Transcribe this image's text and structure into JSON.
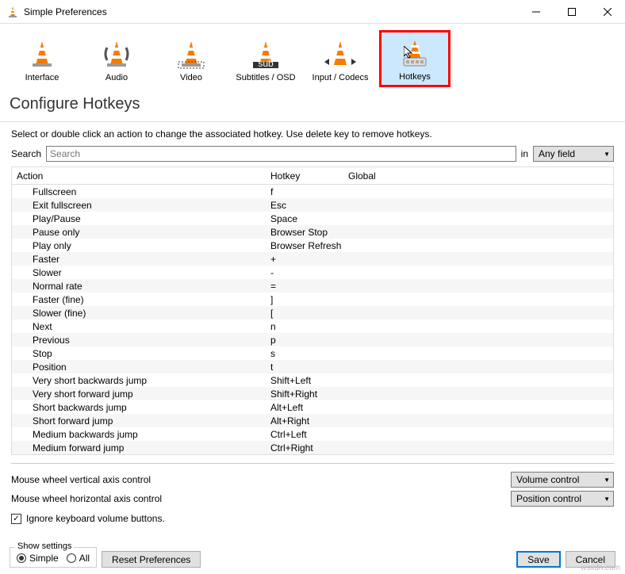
{
  "window": {
    "title": "Simple Preferences"
  },
  "tabs": {
    "items": [
      {
        "label": "Interface"
      },
      {
        "label": "Audio"
      },
      {
        "label": "Video"
      },
      {
        "label": "Subtitles / OSD"
      },
      {
        "label": "Input / Codecs"
      },
      {
        "label": "Hotkeys"
      }
    ]
  },
  "page": {
    "title": "Configure Hotkeys",
    "info": "Select or double click an action to change the associated hotkey. Use delete key to remove hotkeys.",
    "search_label": "Search",
    "search_placeholder": "Search",
    "in_label": "in",
    "search_field_select": "Any field"
  },
  "table": {
    "headers": {
      "action": "Action",
      "hotkey": "Hotkey",
      "global": "Global"
    },
    "rows": [
      {
        "action": "Fullscreen",
        "hotkey": "f",
        "global": ""
      },
      {
        "action": "Exit fullscreen",
        "hotkey": "Esc",
        "global": ""
      },
      {
        "action": "Play/Pause",
        "hotkey": "Space",
        "global": ""
      },
      {
        "action": "Pause only",
        "hotkey": "Browser Stop",
        "global": ""
      },
      {
        "action": "Play only",
        "hotkey": "Browser Refresh",
        "global": ""
      },
      {
        "action": "Faster",
        "hotkey": "+",
        "global": ""
      },
      {
        "action": "Slower",
        "hotkey": "-",
        "global": ""
      },
      {
        "action": "Normal rate",
        "hotkey": "=",
        "global": ""
      },
      {
        "action": "Faster (fine)",
        "hotkey": "]",
        "global": ""
      },
      {
        "action": "Slower (fine)",
        "hotkey": "[",
        "global": ""
      },
      {
        "action": "Next",
        "hotkey": "n",
        "global": ""
      },
      {
        "action": "Previous",
        "hotkey": "p",
        "global": ""
      },
      {
        "action": "Stop",
        "hotkey": "s",
        "global": ""
      },
      {
        "action": "Position",
        "hotkey": "t",
        "global": ""
      },
      {
        "action": "Very short backwards jump",
        "hotkey": "Shift+Left",
        "global": ""
      },
      {
        "action": "Very short forward jump",
        "hotkey": "Shift+Right",
        "global": ""
      },
      {
        "action": "Short backwards jump",
        "hotkey": "Alt+Left",
        "global": ""
      },
      {
        "action": "Short forward jump",
        "hotkey": "Alt+Right",
        "global": ""
      },
      {
        "action": "Medium backwards jump",
        "hotkey": "Ctrl+Left",
        "global": ""
      },
      {
        "action": "Medium forward jump",
        "hotkey": "Ctrl+Right",
        "global": ""
      }
    ]
  },
  "options": {
    "wheel_v_label": "Mouse wheel vertical axis control",
    "wheel_v_value": "Volume control",
    "wheel_h_label": "Mouse wheel horizontal axis control",
    "wheel_h_value": "Position control",
    "ignore_kb_label": "Ignore keyboard volume buttons.",
    "ignore_kb_checked": true
  },
  "footer": {
    "show_settings_legend": "Show settings",
    "radio_simple": "Simple",
    "radio_all": "All",
    "reset": "Reset Preferences",
    "save": "Save",
    "cancel": "Cancel"
  },
  "watermark": "wsxdn.com"
}
